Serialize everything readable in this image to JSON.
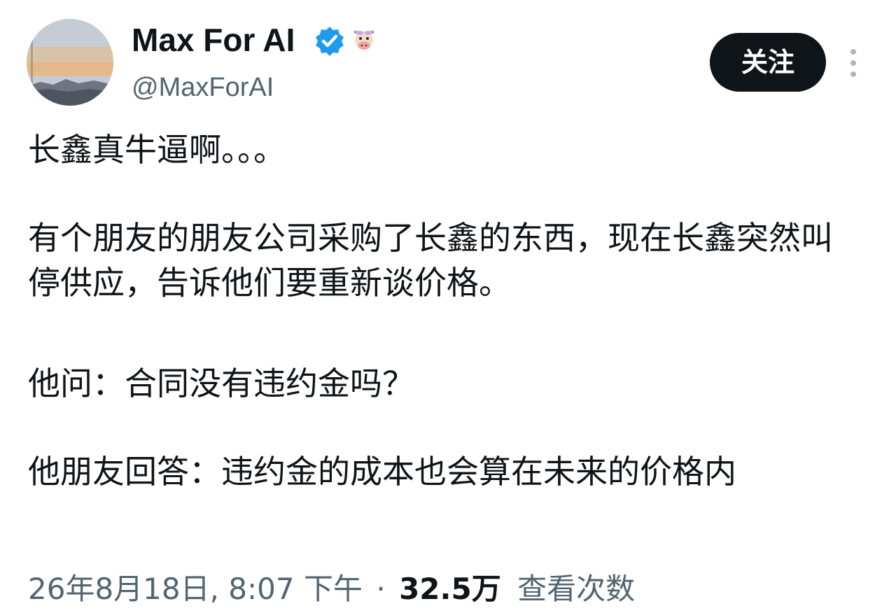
{
  "author": {
    "display_name": "Max For AI",
    "handle": "@MaxForAI",
    "badges": [
      "verified-badge-icon",
      "cow-emoji-icon"
    ]
  },
  "actions": {
    "follow_label": "关注",
    "more_icon": "more-vertical-icon"
  },
  "tweet": {
    "paragraphs": [
      "长鑫真牛逼啊。。。",
      "有个朋友的朋友公司采购了长鑫的东西，现在长鑫突然叫停供应，告诉他们要重新谈价格。",
      "他问：合同没有违约金吗？",
      "他朋友回答：违约金的成本也会算在未来的价格内"
    ]
  },
  "meta": {
    "datetime": "26年8月18日, 8:07 下午",
    "separator": "·",
    "views_count": "32.5万",
    "views_label": "查看次数"
  },
  "colors": {
    "text_primary": "#0f1419",
    "text_secondary": "#536471",
    "verified_blue": "#1d9bf0",
    "button_bg": "#0f1419"
  }
}
